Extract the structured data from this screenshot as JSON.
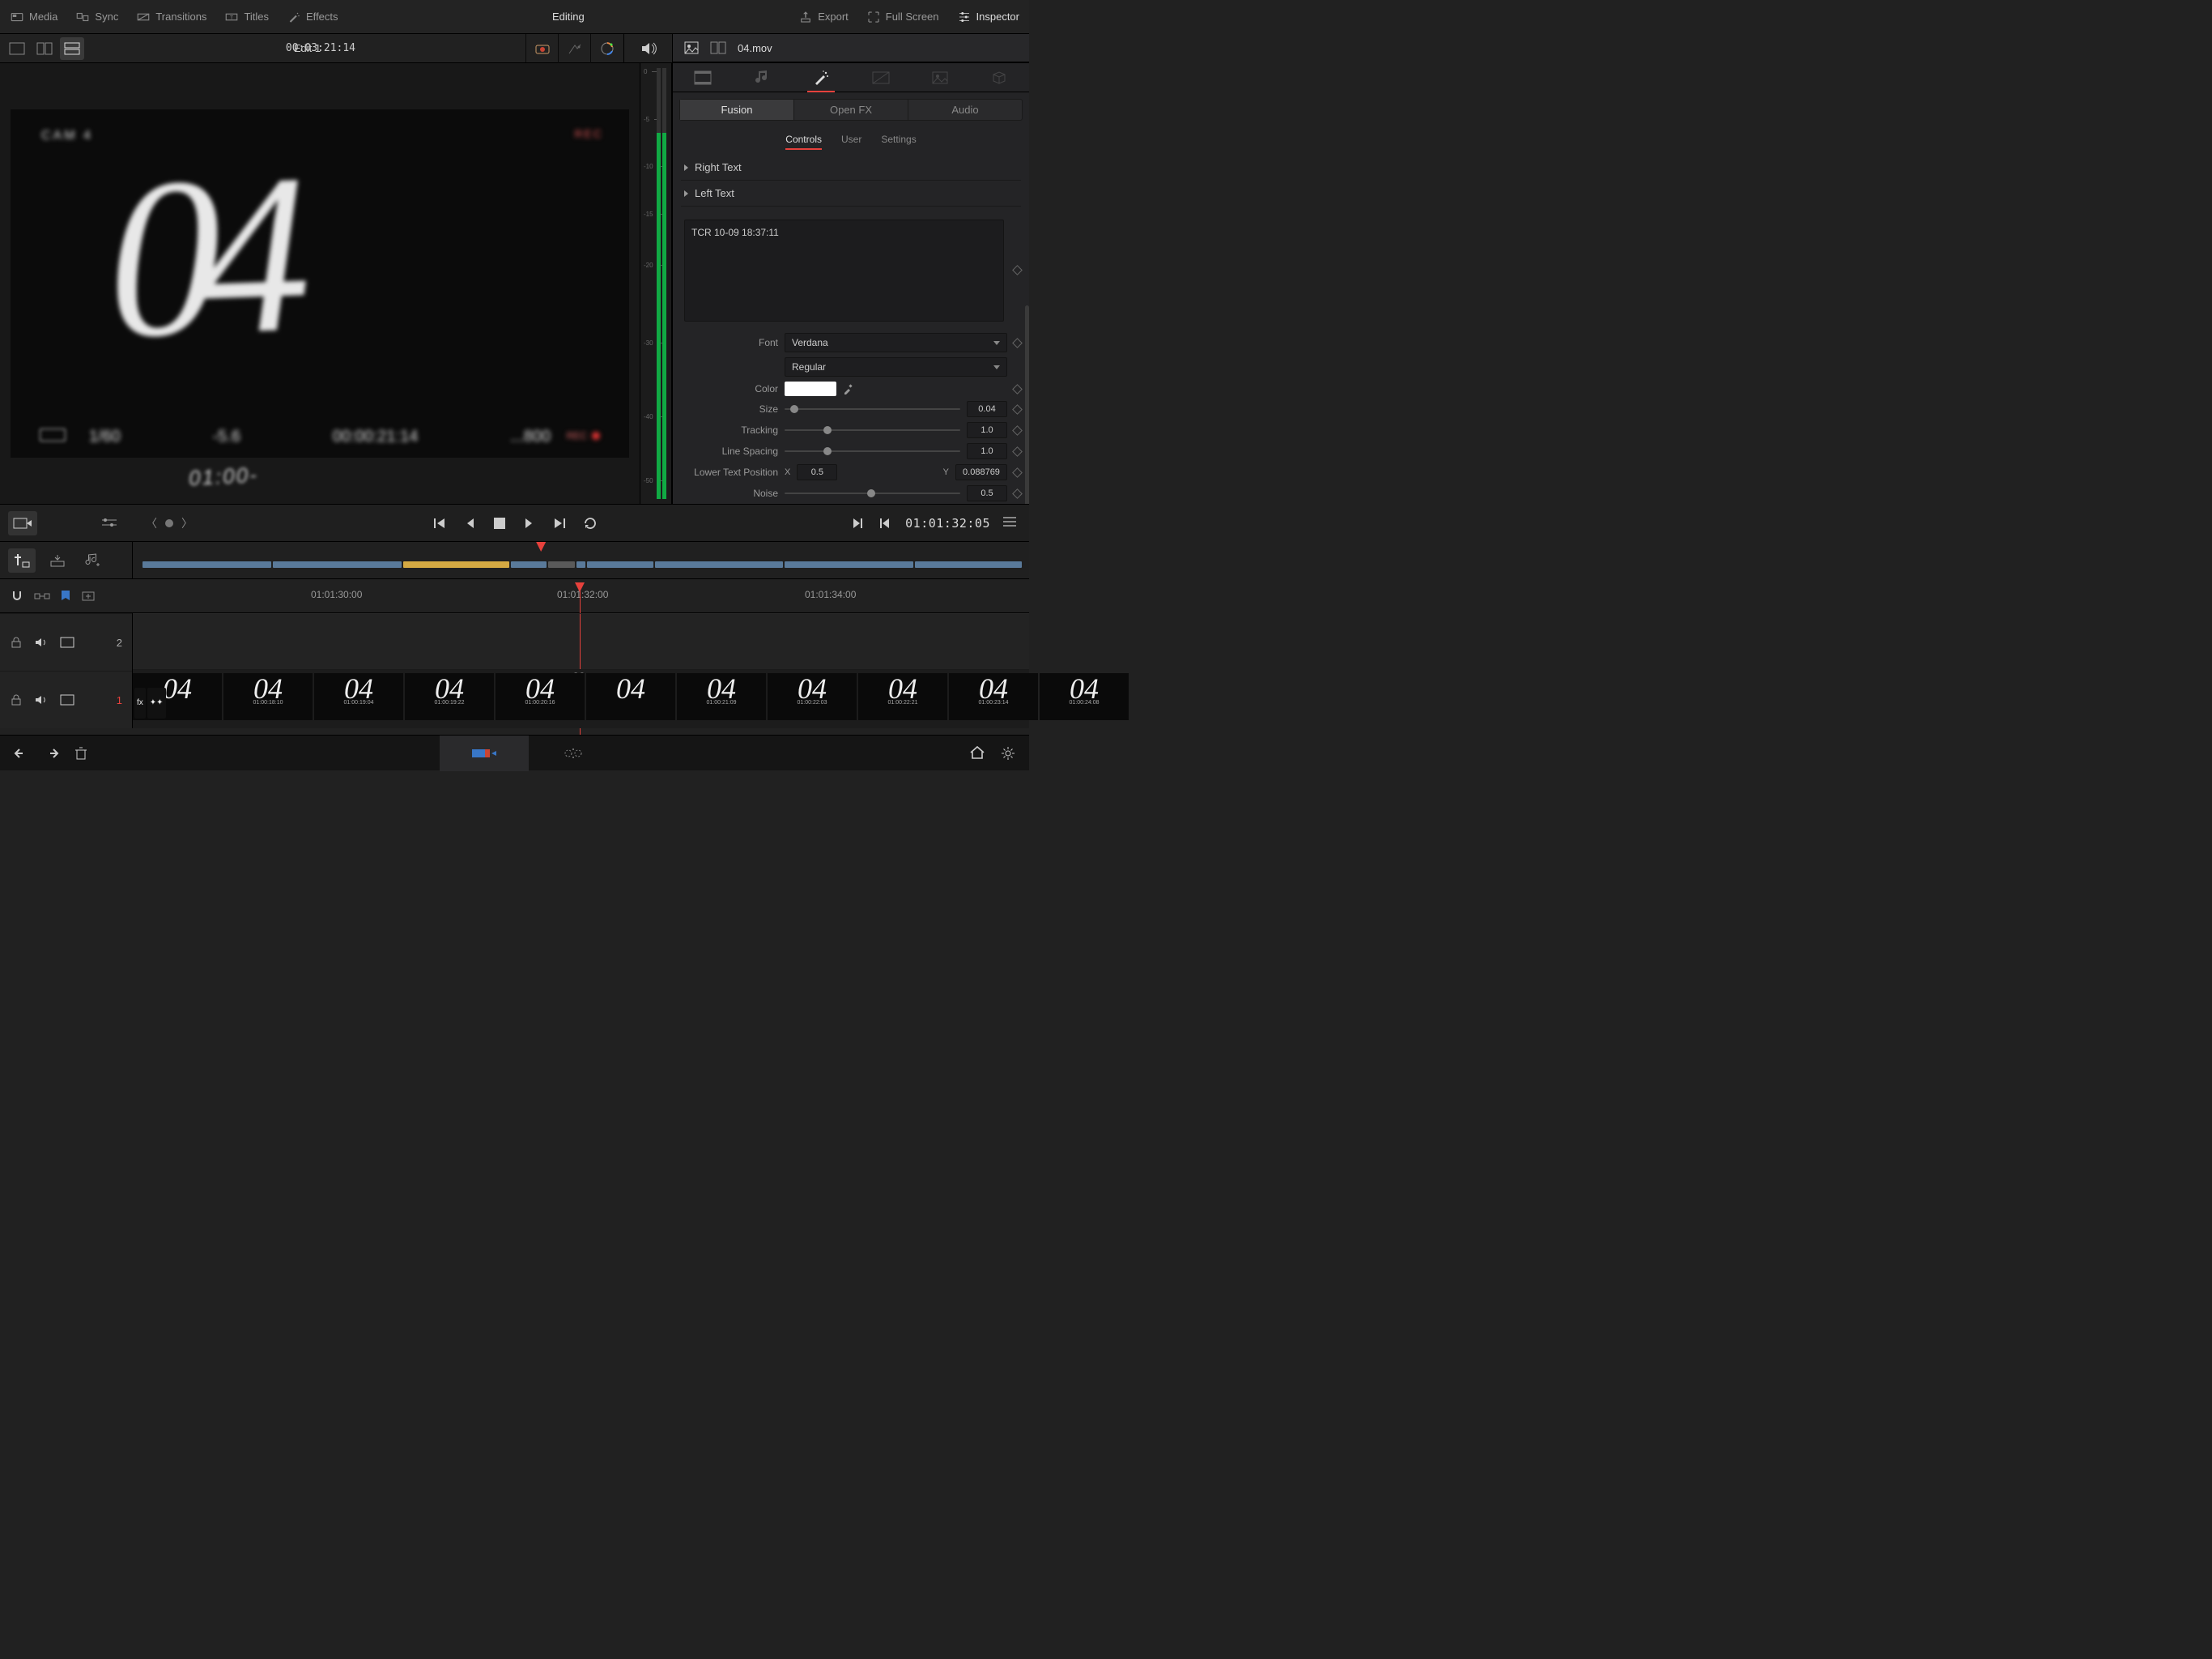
{
  "top_menu": {
    "media": "Media",
    "sync": "Sync",
    "transitions": "Transitions",
    "titles": "Titles",
    "effects": "Effects",
    "title": "Editing",
    "export": "Export",
    "fullscreen": "Full Screen",
    "inspector": "Inspector"
  },
  "toolbar": {
    "project_name": "Edit 1",
    "viewer_tc": "00:03:21:14"
  },
  "clip": {
    "name": "04.mov"
  },
  "viewer": {
    "slate_num": "04",
    "slate_tc_small": "01:00-",
    "slate_shutter": "1/60",
    "slate_fstop": "-5.6",
    "slate_tc_big": "00:00:21:14",
    "slate_iso": "...800",
    "slate_cam": "CAM 4",
    "slate_rec_txt": "REC",
    "slate_rec": "REC"
  },
  "meter_ticks": [
    "0",
    "-5",
    "-10",
    "-15",
    "-20",
    "-30",
    "-40",
    "-50"
  ],
  "inspector": {
    "sub_tabs": {
      "fusion": "Fusion",
      "openfx": "Open FX",
      "audio": "Audio"
    },
    "ctl_tabs": {
      "controls": "Controls",
      "user": "User",
      "settings": "Settings"
    },
    "sections": {
      "right_text": "Right Text",
      "left_text": "Left Text"
    },
    "text_content": "TCR 10-09 18:37:11",
    "rows": {
      "font_label": "Font",
      "font_value": "Verdana",
      "weight_value": "Regular",
      "color_label": "Color",
      "size_label": "Size",
      "size_value": "0.04",
      "tracking_label": "Tracking",
      "tracking_value": "1.0",
      "linespacing_label": "Line Spacing",
      "linespacing_value": "1.0",
      "ltp_label": "Lower Text Position",
      "ltp_x_lbl": "X",
      "ltp_x": "0.5",
      "ltp_y_lbl": "Y",
      "ltp_y": "0.088769",
      "noise_label": "Noise",
      "noise_value": "0.5"
    }
  },
  "transport": {
    "tc": "01:01:32:05"
  },
  "ruler": {
    "t0": "01:01:30:00",
    "t1": "01:01:32:00",
    "t2": "01:01:34:00"
  },
  "tracks": {
    "v2_num": "2",
    "v1_num": "1"
  },
  "thumbs": [
    {
      "tc": ""
    },
    {
      "tc": "01:00:18:10"
    },
    {
      "tc": "01:00:19:04"
    },
    {
      "tc": "01:00:19:22"
    },
    {
      "tc": "01:00:20:16"
    },
    {
      "tc": ""
    },
    {
      "tc": "01:00:21:09"
    },
    {
      "tc": "01:00:22:03"
    },
    {
      "tc": "01:00:22:21"
    },
    {
      "tc": "01:00:23:14"
    },
    {
      "tc": "01:00:24:08"
    }
  ],
  "thumb_num": "04"
}
